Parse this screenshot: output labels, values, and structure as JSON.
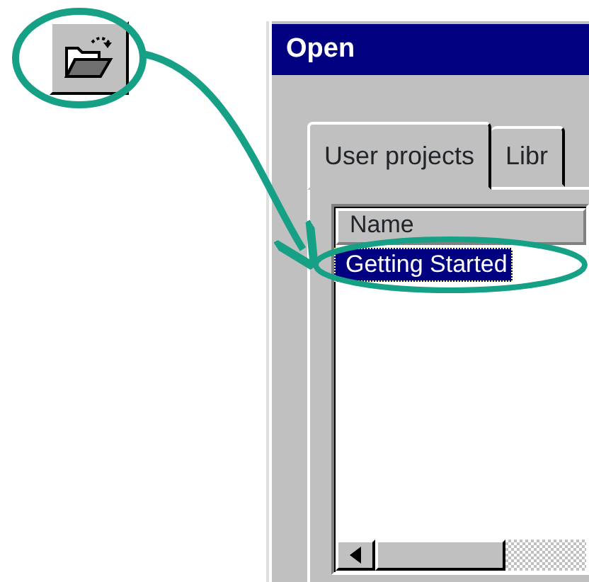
{
  "dialog": {
    "title": "Open",
    "tabs": [
      {
        "label": "User projects",
        "selected": true
      },
      {
        "label": "Libr",
        "selected": false
      }
    ],
    "list": {
      "columns": [
        "Name"
      ],
      "rows": [
        {
          "name": "Getting Started",
          "selected": true
        }
      ]
    }
  }
}
